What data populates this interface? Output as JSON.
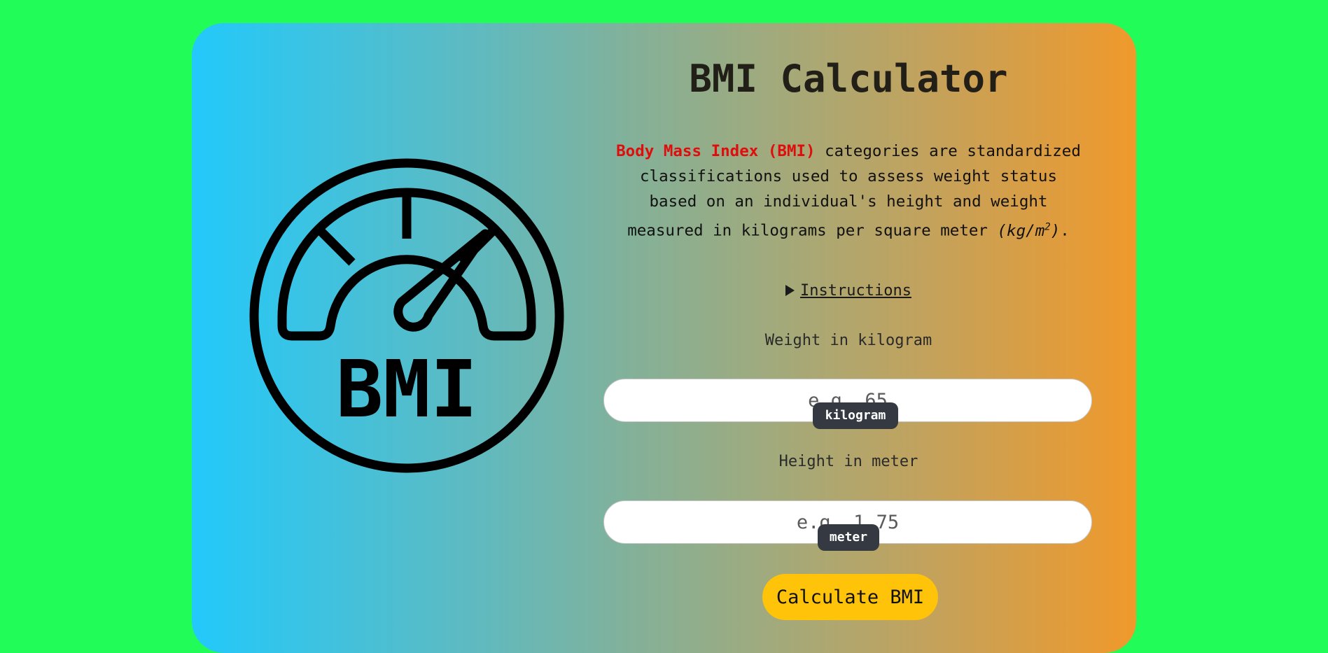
{
  "logo": {
    "text": "BMI",
    "icon": "bmi-gauge-icon"
  },
  "header": {
    "title": "BMI Calculator"
  },
  "description": {
    "term": "Body Mass Index (BMI)",
    "text": " categories are standardized classifications used to assess weight status based on an individual's height and weight measured in kilograms per square meter ",
    "unit_open": "(kg/m",
    "unit_sup": "2",
    "unit_close": ")",
    "end": "."
  },
  "instructions": {
    "label": "Instructions",
    "icon": "disclosure-triangle-icon"
  },
  "weight": {
    "label": "Weight in kilogram",
    "placeholder": "e.g. 65",
    "value": "",
    "unit": "kilogram"
  },
  "height": {
    "label": "Height in meter",
    "placeholder": "e.g. 1.75",
    "value": "",
    "unit": "meter"
  },
  "actions": {
    "calculate_label": "Calculate BMI"
  },
  "colors": {
    "page_background": "#22fc58",
    "gradient_start": "#22c9fb",
    "gradient_end": "#f0992b",
    "term_highlight": "#e00d0d",
    "button": "#ffc30a",
    "badge": "#353a42"
  }
}
